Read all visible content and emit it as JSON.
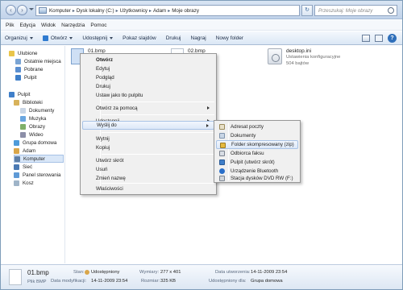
{
  "address": {
    "crumbs": [
      "Komputer",
      "Dysk lokalny (C:)",
      "Użytkownicy",
      "Adam",
      "Moje obrazy"
    ],
    "search_placeholder": "Przeszukaj: Moje obrazy"
  },
  "menubar": [
    "Plik",
    "Edycja",
    "Widok",
    "Narzędzia",
    "Pomoc"
  ],
  "toolbar": {
    "organize": "Organizuj",
    "open": "Otwórz",
    "share": "Udostępnij",
    "slideshow": "Pokaz slajdów",
    "print": "Drukuj",
    "burn": "Nagraj",
    "new_folder": "Nowy folder"
  },
  "sidebar": {
    "items": [
      "Ulubione",
      "Ostatnie miejsca",
      "Pobrane",
      "Pulpit",
      "Pulpit",
      "Biblioteki",
      "Dokumenty",
      "Muzyka",
      "Obrazy",
      "Wideo",
      "Grupa domowa",
      "Adam",
      "Komputer",
      "Sieć",
      "Panel sterowania",
      "Kosz"
    ]
  },
  "files": [
    {
      "name": "01.bmp"
    },
    {
      "name": "02.bmp"
    },
    {
      "name": "desktop.ini",
      "type": "Ustawienia konfiguracyjne",
      "size": "504 bajtów"
    }
  ],
  "context_menu": {
    "items": [
      "Otwórz",
      "Edytuj",
      "Podgląd",
      "Drukuj",
      "Ustaw jako tło pulpitu",
      "Otwórz za pomocą",
      "Udostępnij",
      "Wyślij do",
      "Wytnij",
      "Kopiuj",
      "Utwórz skrót",
      "Usuń",
      "Zmień nazwę",
      "Właściwości"
    ]
  },
  "send_to": {
    "items": [
      "Adresat poczty",
      "Dokumenty",
      "Folder skompresowany (zip)",
      "Odbiorca faksu",
      "Pulpit (utwórz skrót)",
      "Urządzenie Bluetooth",
      "Stacja dysków DVD RW (F:)"
    ]
  },
  "details": {
    "name": "01.bmp",
    "type": "Plik BMP",
    "state_label": "Stan:",
    "state_value": "Udostępniony",
    "modified_label": "Data modyfikacji:",
    "modified_value": "14-11-2009 23:54",
    "dimensions_label": "Wymiary:",
    "dimensions_value": "277 x 401",
    "size_label": "Rozmiar:",
    "size_value": "325 KB",
    "created_label": "Data utworzenia:",
    "created_value": "14-11-2009 23:54",
    "shared_label": "Udostępniony dla:",
    "shared_value": "Grupa domowa"
  },
  "colors": {
    "accent": "#2f6fba",
    "selection": "#d9e7f8",
    "menu_bg": "#f0f0f0"
  }
}
